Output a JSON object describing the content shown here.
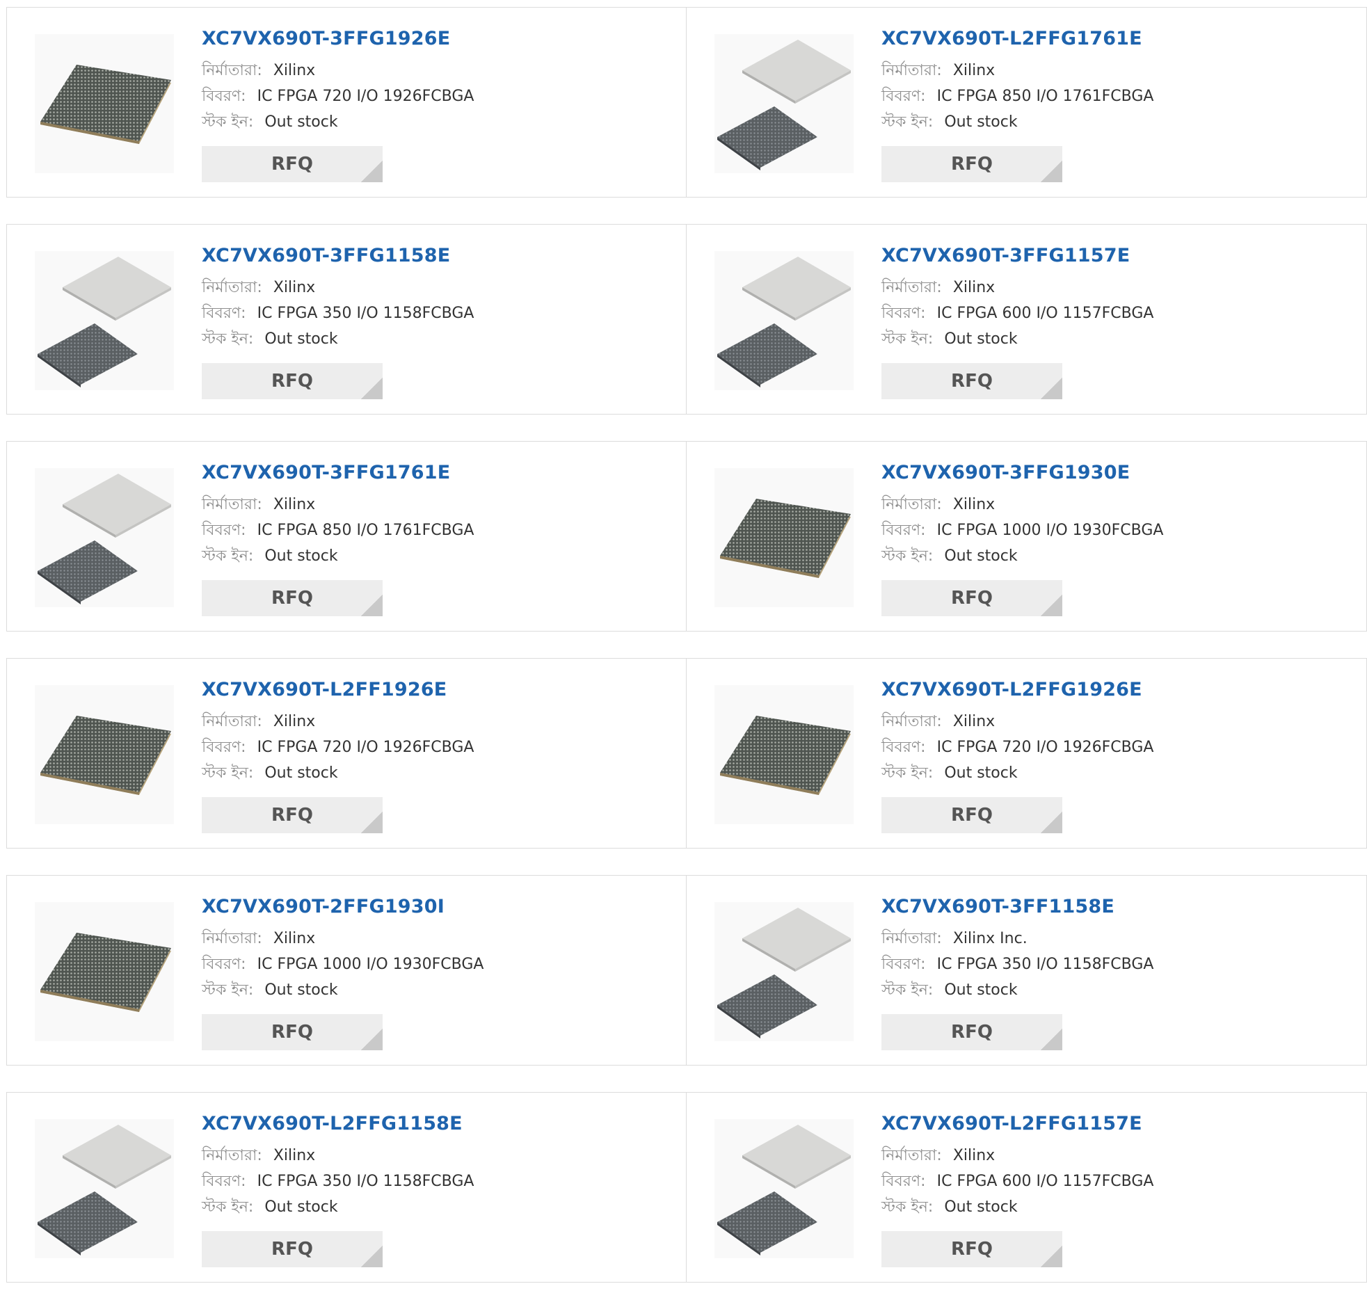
{
  "labels": {
    "manufacturer": "নির্মাতারা:",
    "description": "বিবরণ:",
    "stock": "স্টক ইন:"
  },
  "rows": [
    [
      {
        "part": "XC7VX690T-3FFG1926E",
        "manufacturer": "Xilinx",
        "description": "IC FPGA 720 I/O 1926FCBGA",
        "stock": "Out stock",
        "button": "RFQ",
        "image": "single-bga-chip"
      },
      {
        "part": "XC7VX690T-L2FFG1761E",
        "manufacturer": "Xilinx",
        "description": "IC FPGA 850 I/O 1761FCBGA",
        "stock": "Out stock",
        "button": "RFQ",
        "image": "lidded-bga-pair"
      }
    ],
    [
      {
        "part": "XC7VX690T-3FFG1158E",
        "manufacturer": "Xilinx",
        "description": "IC FPGA 350 I/O 1158FCBGA",
        "stock": "Out stock",
        "button": "RFQ",
        "image": "lidded-bga-pair"
      },
      {
        "part": "XC7VX690T-3FFG1157E",
        "manufacturer": "Xilinx",
        "description": "IC FPGA 600 I/O 1157FCBGA",
        "stock": "Out stock",
        "button": "RFQ",
        "image": "lidded-bga-pair"
      }
    ],
    [
      {
        "part": "XC7VX690T-3FFG1761E",
        "manufacturer": "Xilinx",
        "description": "IC FPGA 850 I/O 1761FCBGA",
        "stock": "Out stock",
        "button": "RFQ",
        "image": "lidded-bga-pair"
      },
      {
        "part": "XC7VX690T-3FFG1930E",
        "manufacturer": "Xilinx",
        "description": "IC FPGA 1000 I/O 1930FCBGA",
        "stock": "Out stock",
        "button": "RFQ",
        "image": "single-bga-chip"
      }
    ],
    [
      {
        "part": "XC7VX690T-L2FF1926E",
        "manufacturer": "Xilinx",
        "description": "IC FPGA 720 I/O 1926FCBGA",
        "stock": "Out stock",
        "button": "RFQ",
        "image": "single-bga-chip"
      },
      {
        "part": "XC7VX690T-L2FFG1926E",
        "manufacturer": "Xilinx",
        "description": "IC FPGA 720 I/O 1926FCBGA",
        "stock": "Out stock",
        "button": "RFQ",
        "image": "single-bga-chip"
      }
    ],
    [
      {
        "part": "XC7VX690T-2FFG1930I",
        "manufacturer": "Xilinx",
        "description": "IC FPGA 1000 I/O 1930FCBGA",
        "stock": "Out stock",
        "button": "RFQ",
        "image": "single-bga-chip"
      },
      {
        "part": "XC7VX690T-3FF1158E",
        "manufacturer": "Xilinx Inc.",
        "description": "IC FPGA 350 I/O 1158FCBGA",
        "stock": "Out stock",
        "button": "RFQ",
        "image": "lidded-bga-pair"
      }
    ],
    [
      {
        "part": "XC7VX690T-L2FFG1158E",
        "manufacturer": "Xilinx",
        "description": "IC FPGA 350 I/O 1158FCBGA",
        "stock": "Out stock",
        "button": "RFQ",
        "image": "lidded-bga-pair"
      },
      {
        "part": "XC7VX690T-L2FFG1157E",
        "manufacturer": "Xilinx",
        "description": "IC FPGA 600 I/O 1157FCBGA",
        "stock": "Out stock",
        "button": "RFQ",
        "image": "lidded-bga-pair"
      }
    ]
  ],
  "colors": {
    "link": "#1e63ad",
    "label": "#8e8e8e",
    "border": "#dcdcdc",
    "button_bg": "#ededed",
    "button_text": "#555555"
  }
}
